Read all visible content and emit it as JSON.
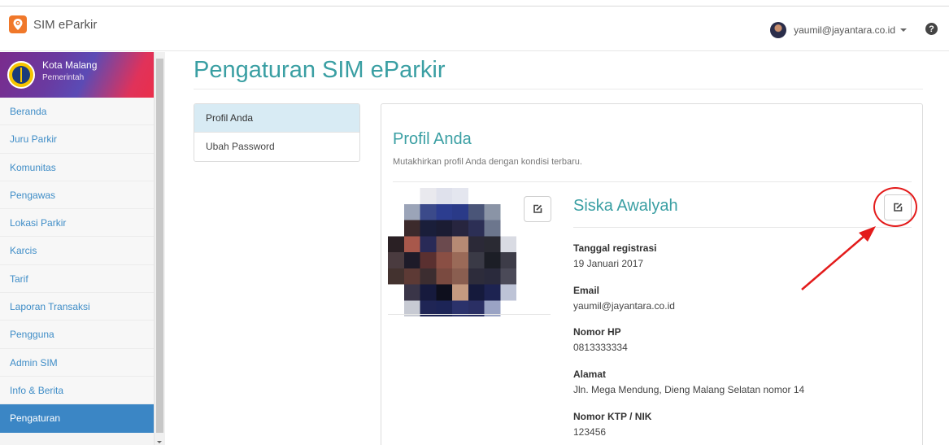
{
  "app": {
    "title": "SIM eParkir"
  },
  "user": {
    "email": "yaumil@jayantara.co.id"
  },
  "sidebar": {
    "org_name": "Kota Malang",
    "org_sub": "Pemerintah",
    "items": [
      {
        "label": "Beranda"
      },
      {
        "label": "Juru Parkir"
      },
      {
        "label": "Komunitas"
      },
      {
        "label": "Pengawas"
      },
      {
        "label": "Lokasi Parkir"
      },
      {
        "label": "Karcis"
      },
      {
        "label": "Tarif"
      },
      {
        "label": "Laporan Transaksi"
      },
      {
        "label": "Pengguna"
      },
      {
        "label": "Admin SIM"
      },
      {
        "label": "Info & Berita"
      },
      {
        "label": "Pengaturan",
        "active": true
      }
    ]
  },
  "page": {
    "title": "Pengaturan SIM eParkir"
  },
  "settings_menu": {
    "items": [
      {
        "label": "Profil Anda",
        "active": true
      },
      {
        "label": "Ubah Password"
      }
    ]
  },
  "profile": {
    "title": "Profil Anda",
    "subtitle": "Mutakhirkan profil Anda dengan kondisi terbaru.",
    "name": "Siska Awalyah",
    "fields": [
      {
        "label": "Tanggal registrasi",
        "value": "19 Januari 2017"
      },
      {
        "label": "Email",
        "value": "yaumil@jayantara.co.id"
      },
      {
        "label": "Nomor HP",
        "value": "0813333334"
      },
      {
        "label": "Alamat",
        "value": "Jln. Mega Mendung, Dieng Malang Selatan nomor 14"
      },
      {
        "label": "Nomor KTP / NIK",
        "value": "123456"
      }
    ]
  },
  "icons": {
    "brand": "location-pin-icon",
    "help": "question-circle-icon",
    "edit": "edit-icon"
  },
  "colors": {
    "accent": "#3a9fa3",
    "nav_link": "#3f8dc7",
    "nav_active": "#3b86c5",
    "brand": "#f0782a",
    "annotation": "#e31b1b"
  }
}
